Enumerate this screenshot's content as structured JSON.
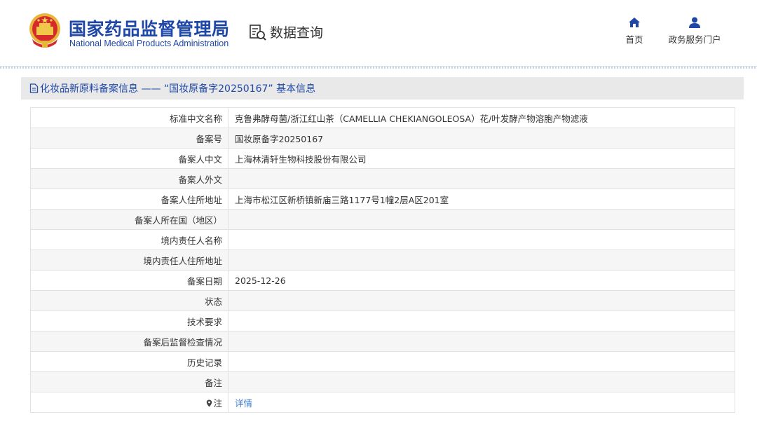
{
  "header": {
    "agency_cn": "国家药品监督管理局",
    "agency_en": "National Medical Products Administration",
    "section_title": "数据查询",
    "nav": [
      {
        "label": "首页",
        "icon": "home-icon"
      },
      {
        "label": "政务服务门户",
        "icon": "user-icon"
      }
    ]
  },
  "colors": {
    "brand_blue": "#1e47a8",
    "link_blue": "#3f7fd0",
    "panel_head_bg": "#e9e9e9",
    "row_alt_bg": "#f6f6f6"
  },
  "panel": {
    "title": "化妆品新原料备案信息 —— “国妆原备字20250167” 基本信息",
    "rows": [
      {
        "label": "标准中文名称",
        "value": "克鲁弗酵母菌/浙江红山茶（CAMELLIA CHEKIANGOLEOSA）花/叶发酵产物溶胞产物滤液"
      },
      {
        "label": "备案号",
        "value": "国妆原备字20250167"
      },
      {
        "label": "备案人中文",
        "value": "上海林清轩生物科技股份有限公司"
      },
      {
        "label": "备案人外文",
        "value": ""
      },
      {
        "label": "备案人住所地址",
        "value": "上海市松江区新桥镇新庙三路1177号1幢2层A区201室"
      },
      {
        "label": "备案人所在国（地区）",
        "value": ""
      },
      {
        "label": "境内责任人名称",
        "value": ""
      },
      {
        "label": "境内责任人住所地址",
        "value": ""
      },
      {
        "label": "备案日期",
        "value": "2025-12-26"
      },
      {
        "label": "状态",
        "value": ""
      },
      {
        "label": "技术要求",
        "value": ""
      },
      {
        "label": "备案后监督检查情况",
        "value": ""
      },
      {
        "label": "历史记录",
        "value": ""
      },
      {
        "label": "备注",
        "value": ""
      }
    ],
    "note_row": {
      "label": "注",
      "link": "详情",
      "icon": "pin-icon"
    }
  }
}
